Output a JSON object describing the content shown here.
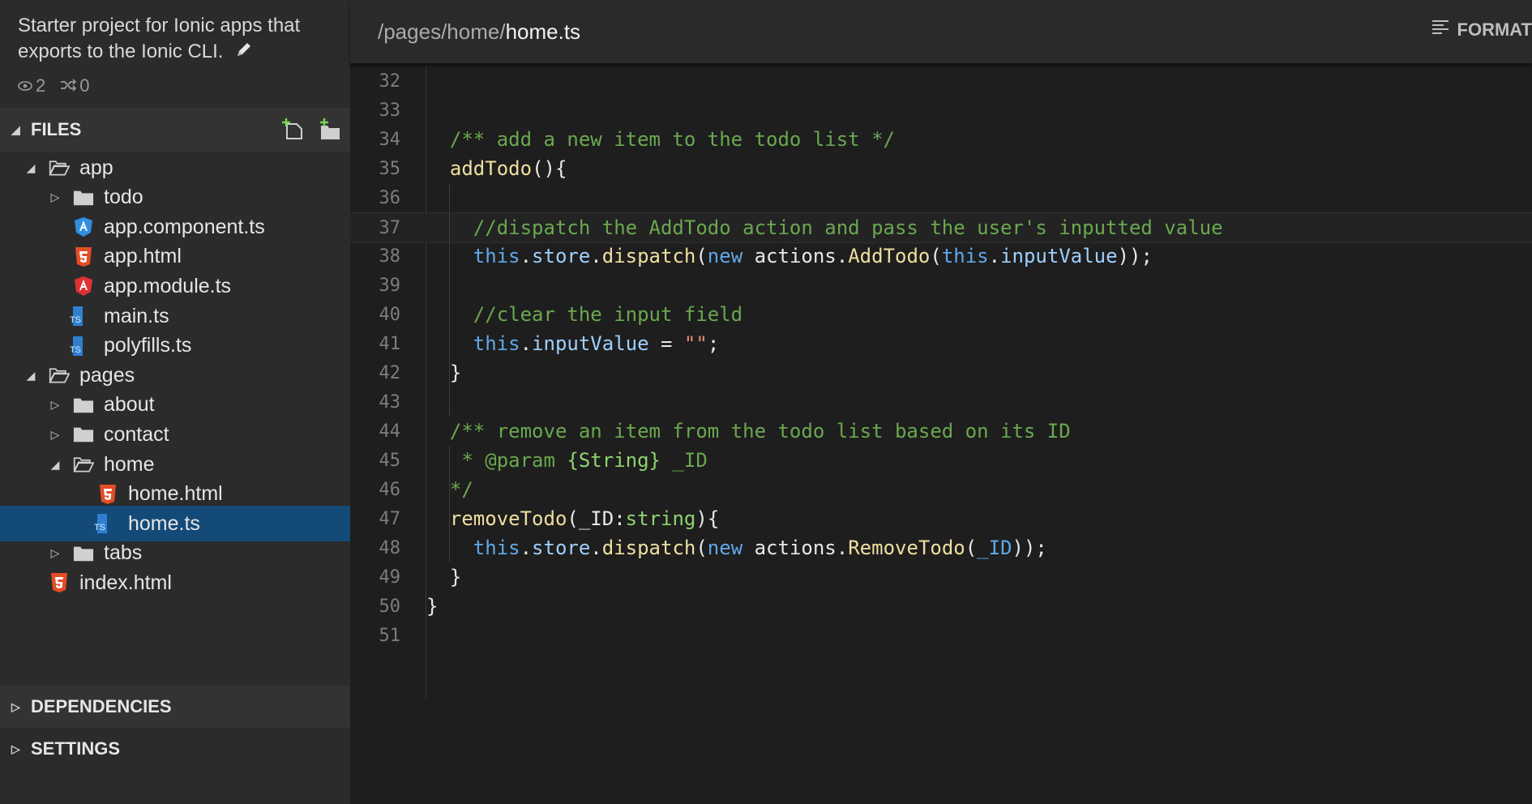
{
  "project": {
    "description": "Starter project for Ionic apps that exports to the Ionic CLI.",
    "watchers": "2",
    "forks": "0"
  },
  "sections": {
    "files": "FILES",
    "dependencies": "DEPENDENCIES",
    "settings": "SETTINGS"
  },
  "tree": [
    {
      "label": "app",
      "kind": "folder-open",
      "depth": 0
    },
    {
      "label": "todo",
      "kind": "folder",
      "depth": 1
    },
    {
      "label": "app.component.ts",
      "kind": "angular-blue",
      "depth": 1
    },
    {
      "label": "app.html",
      "kind": "html5",
      "depth": 1
    },
    {
      "label": "app.module.ts",
      "kind": "angular-red",
      "depth": 1
    },
    {
      "label": "main.ts",
      "kind": "typescript",
      "depth": 1
    },
    {
      "label": "polyfills.ts",
      "kind": "typescript",
      "depth": 1
    },
    {
      "label": "pages",
      "kind": "folder-open",
      "depth": 0
    },
    {
      "label": "about",
      "kind": "folder",
      "depth": 1
    },
    {
      "label": "contact",
      "kind": "folder",
      "depth": 1
    },
    {
      "label": "home",
      "kind": "folder-open",
      "depth": 1
    },
    {
      "label": "home.html",
      "kind": "html5",
      "depth": 2
    },
    {
      "label": "home.ts",
      "kind": "typescript",
      "depth": 2,
      "selected": true
    },
    {
      "label": "tabs",
      "kind": "folder",
      "depth": 1
    },
    {
      "label": "index.html",
      "kind": "html5",
      "depth": 0
    }
  ],
  "editor": {
    "path_prefix": "/pages/home/",
    "file_name": "home.ts",
    "format_label": "FORMAT"
  },
  "code": {
    "line_numbers": [
      "32",
      "33",
      "34",
      "35",
      "36",
      "37",
      "38",
      "39",
      "40",
      "41",
      "42",
      "43",
      "44",
      "45",
      "46",
      "47",
      "48",
      "49",
      "50",
      "51"
    ],
    "lines": [
      "",
      "",
      "  /** add a new item to the todo list */",
      "  addTodo(){",
      "",
      "    //dispatch the AddTodo action and pass the user's inputted value",
      "    this.store.dispatch(new actions.AddTodo(this.inputValue));",
      "",
      "    //clear the input field",
      "    this.inputValue = \"\";",
      "  }",
      "",
      "  /** remove an item from the todo list based on its ID",
      "   * @param {String} _ID",
      "  */",
      "  removeTodo(_ID:string){",
      "    this.store.dispatch(new actions.RemoveTodo(_ID));",
      "  }",
      "}",
      ""
    ],
    "active_line": "37"
  },
  "colors": {
    "accent_selected": "#144a78",
    "comment": "#6aa84f",
    "keyword": "#5fa8ea",
    "function": "#f0dfa0",
    "string": "#e4917a",
    "html5": "#e44d26",
    "typescript": "#2f7fd1"
  }
}
